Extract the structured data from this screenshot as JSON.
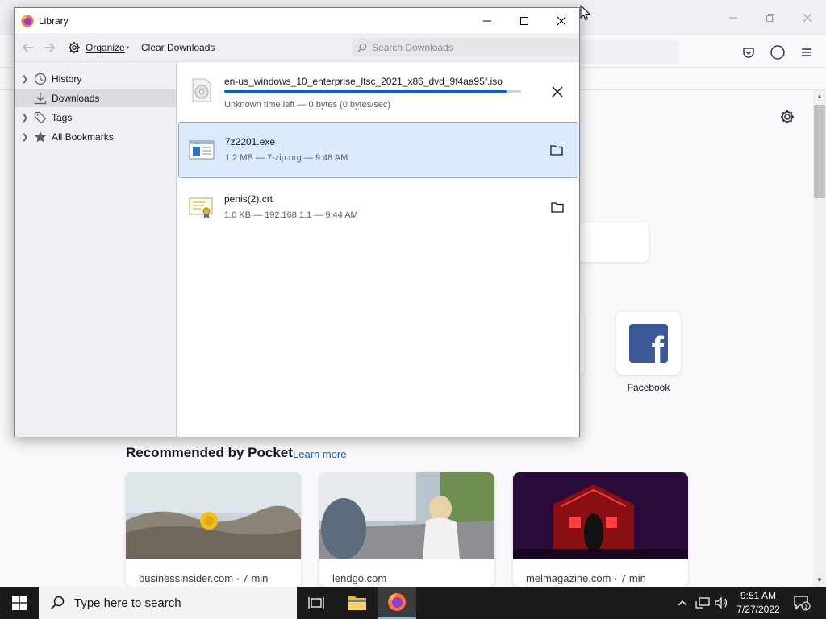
{
  "library": {
    "title": "Library",
    "toolbar": {
      "organize_label": "Organize",
      "clear_label": "Clear Downloads",
      "search_placeholder": "Search Downloads"
    },
    "sidebar": [
      {
        "label": "History",
        "icon": "clock-icon",
        "selected": false
      },
      {
        "label": "Downloads",
        "icon": "download-icon",
        "selected": true
      },
      {
        "label": "Tags",
        "icon": "tag-icon",
        "selected": false
      },
      {
        "label": "All Bookmarks",
        "icon": "star-icon",
        "selected": false
      }
    ],
    "downloads": [
      {
        "name": "en-us_windows_10_enterprise_ltsc_2021_x86_dvd_9f4aa95f.iso",
        "status": "Unknown time left — 0 bytes (0 bytes/sec)",
        "in_progress": true,
        "progress": 0.95,
        "action": "cancel-icon"
      },
      {
        "name": "7z2201.exe",
        "status": "1.2 MB — 7-zip.org — 9:48 AM",
        "in_progress": false,
        "action": "folder-icon",
        "selected": true
      },
      {
        "name": "penis(2).crt",
        "status": "1.0 KB — 192.168.1.1 — 9:44 AM",
        "in_progress": false,
        "action": "folder-icon"
      }
    ]
  },
  "newtab": {
    "shortcut_label": "Facebook",
    "pocket_heading": "Recommended by Pocket",
    "pocket_learn_more": "Learn more",
    "pocket_cards": [
      {
        "source": "businessinsider.com · 7 min"
      },
      {
        "source": "lendgo.com"
      },
      {
        "source": "melmagazine.com · 7 min"
      }
    ]
  },
  "taskbar": {
    "search_placeholder": "Type here to search",
    "time": "9:51 AM",
    "date": "7/27/2022",
    "notification_count": "1"
  },
  "colors": {
    "accent": "#0060df",
    "selected_row": "#dcebfb",
    "facebook": "#3b5998",
    "taskbar": "#1a1a1a"
  }
}
